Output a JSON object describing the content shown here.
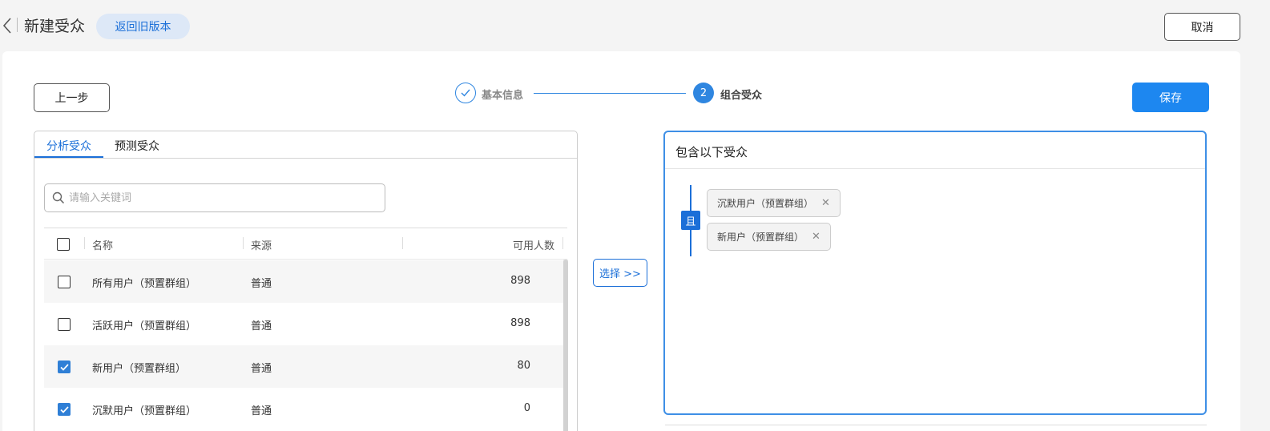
{
  "header": {
    "title": "新建受众",
    "old_version_label": "返回旧版本",
    "cancel_label": "取消"
  },
  "toolbar": {
    "prev_label": "上一步",
    "save_label": "保存"
  },
  "steps": [
    {
      "label": "基本信息",
      "status": "done"
    },
    {
      "number": "2",
      "label": "组合受众",
      "status": "active"
    }
  ],
  "tabs": [
    {
      "label": "分析受众",
      "active": true
    },
    {
      "label": "预测受众",
      "active": false
    }
  ],
  "search": {
    "value": "",
    "placeholder": "请输入关键词"
  },
  "table": {
    "columns": [
      "名称",
      "来源",
      "可用人数"
    ],
    "rows": [
      {
        "name": "所有用户（预置群组）",
        "source": "普通",
        "count": "898",
        "checked": false
      },
      {
        "name": "活跃用户（预置群组）",
        "source": "普通",
        "count": "898",
        "checked": false
      },
      {
        "name": "新用户（预置群组）",
        "source": "普通",
        "count": "80",
        "checked": true
      },
      {
        "name": "沉默用户（预置群组）",
        "source": "普通",
        "count": "0",
        "checked": true
      }
    ]
  },
  "select_button_label": "选择 >>",
  "right_panel": {
    "title": "包含以下受众",
    "logic_label": "且",
    "chips": [
      {
        "label": "沉默用户（预置群组）"
      },
      {
        "label": "新用户（预置群组）"
      }
    ]
  },
  "colors": {
    "primary": "#1d87f0",
    "accent_blue": "#1b6fd8",
    "panel_border": "#3e8fe6"
  }
}
